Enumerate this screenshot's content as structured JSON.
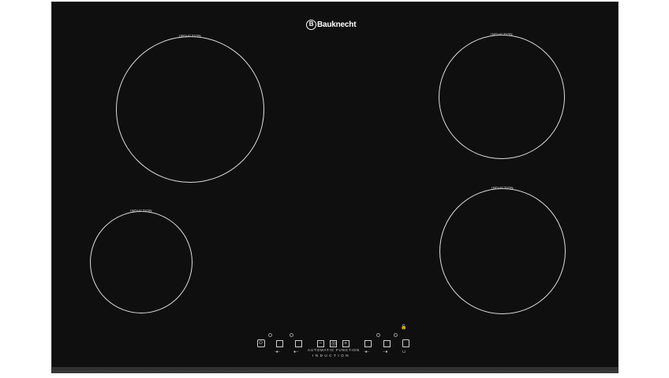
{
  "product": {
    "brand": "Bauknecht"
  },
  "zones": {
    "label": "INDUCTION"
  },
  "controls": {
    "automatic_function": "AUTOMATIC FUNCTION",
    "induction": "INDUCTION",
    "minus": "−",
    "plus": "+",
    "power_symbol": "⏻",
    "lock_symbol": "🔓",
    "timer_symbol": "◎"
  },
  "colors": {
    "glass": "#0f0f0f",
    "lines": "#dcdcdc"
  }
}
